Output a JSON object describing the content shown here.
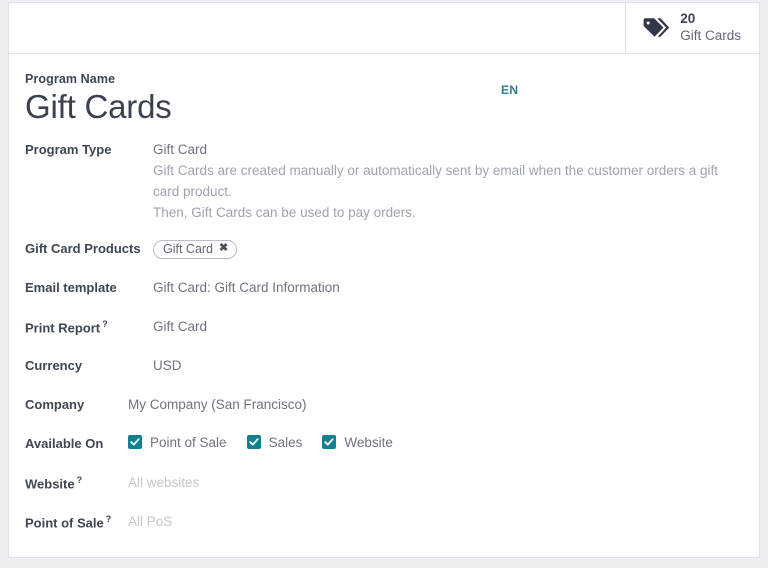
{
  "smart_button": {
    "icon": "tag-icon",
    "value": "20",
    "label": "Gift Cards"
  },
  "title": {
    "label": "Program Name",
    "value": "Gift Cards",
    "lang_badge": "EN"
  },
  "fields": {
    "program_type": {
      "label": "Program Type",
      "value": "Gift Card",
      "help_line_1": "Gift Cards are created manually or automatically sent by email when the customer orders a gift card product.",
      "help_line_2": "Then, Gift Cards can be used to pay orders."
    },
    "gift_card_products": {
      "label": "Gift Card Products",
      "tags": [
        {
          "name": "Gift Card",
          "remove_icon": "✖"
        }
      ]
    },
    "email_template": {
      "label": "Email template",
      "value": "Gift Card: Gift Card Information"
    },
    "print_report": {
      "label": "Print Report",
      "help_mark": "?",
      "value": "Gift Card"
    },
    "currency": {
      "label": "Currency",
      "value": "USD"
    },
    "company": {
      "label": "Company",
      "value": "My Company (San Francisco)"
    },
    "available_on": {
      "label": "Available On",
      "options": [
        {
          "label": "Point of Sale",
          "checked": true
        },
        {
          "label": "Sales",
          "checked": true
        },
        {
          "label": "Website",
          "checked": true
        }
      ]
    },
    "website": {
      "label": "Website",
      "help_mark": "?",
      "placeholder": "All websites"
    },
    "point_of_sale": {
      "label": "Point of Sale",
      "help_mark": "?",
      "placeholder": "All PoS"
    }
  },
  "colors": {
    "accent_teal": "#14808f",
    "lang_badge": "#2b7f93",
    "label_text": "#3f4654",
    "value_text": "#6e7381",
    "placeholder_text": "#c2c6cf"
  }
}
